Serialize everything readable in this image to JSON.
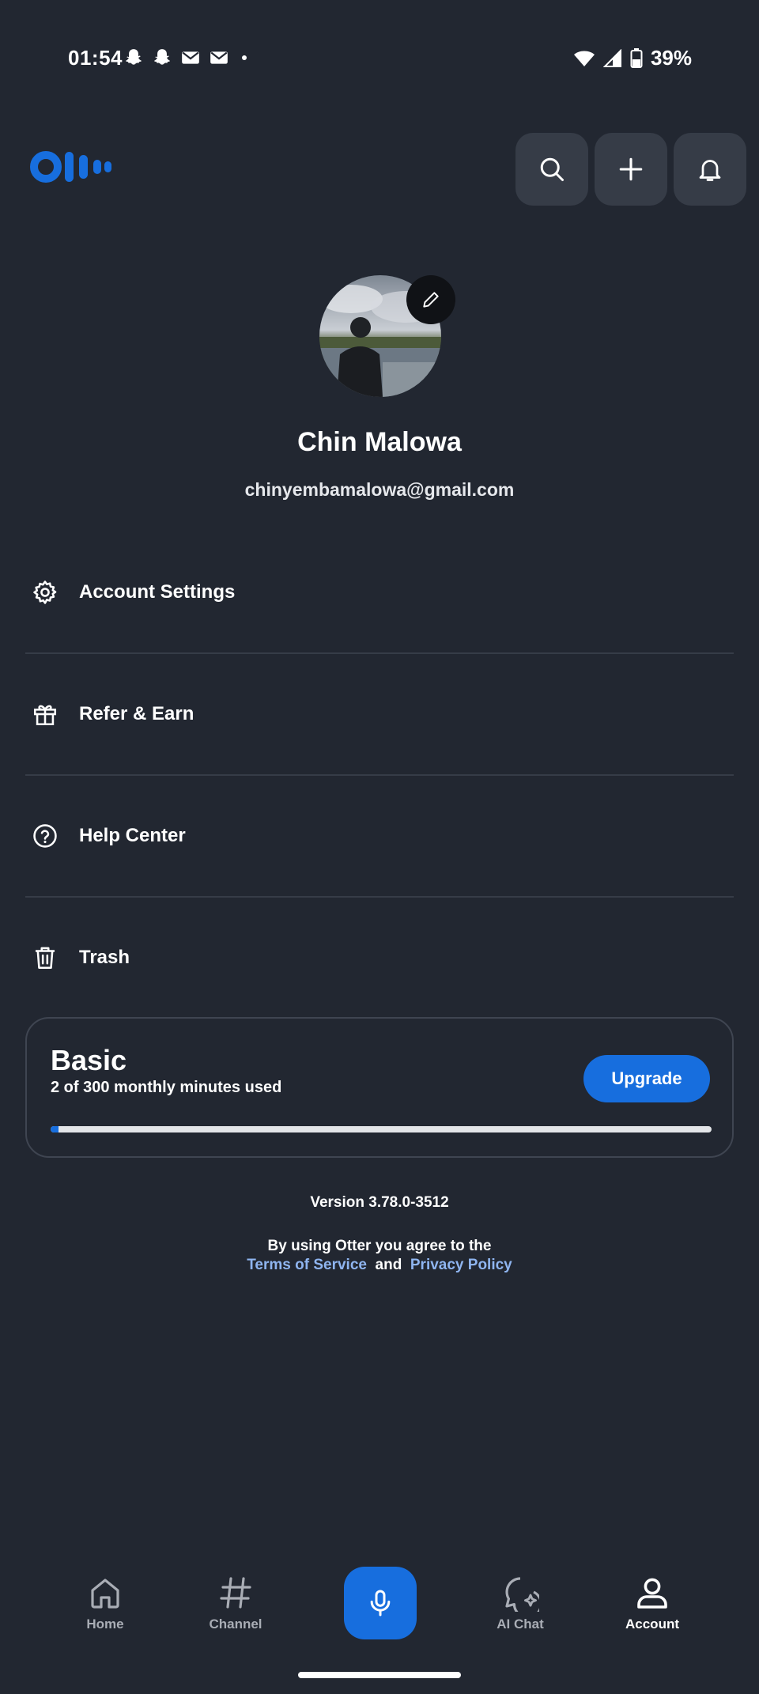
{
  "status_bar": {
    "time": "01:54",
    "notification_icons": [
      "snapchat-icon",
      "snapchat-icon",
      "gmail-icon",
      "gmail-icon",
      "dot-icon"
    ],
    "battery": "39%"
  },
  "header": {
    "logo": "otter-logo",
    "actions": [
      "search-icon",
      "plus-icon",
      "bell-icon"
    ]
  },
  "profile": {
    "name": "Chin Malowa",
    "email": "chinyembamalowa@gmail.com"
  },
  "menu": [
    {
      "label": "Account Settings",
      "icon": "gear-icon"
    },
    {
      "label": "Refer & Earn",
      "icon": "gift-icon"
    },
    {
      "label": "Help Center",
      "icon": "help-circle-icon"
    },
    {
      "label": "Trash",
      "icon": "trash-icon"
    }
  ],
  "plan": {
    "title": "Basic",
    "usage": "2 of 300 monthly minutes used",
    "upgrade_label": "Upgrade",
    "used_fraction": 0.0067
  },
  "footer": {
    "version": "Version 3.78.0-3512",
    "agree_text": "By using Otter you agree to the",
    "terms_label": "Terms of Service",
    "and_text": "and",
    "privacy_label": "Privacy Policy"
  },
  "bottom_nav": [
    {
      "label": "Home",
      "icon": "home-icon"
    },
    {
      "label": "Channel",
      "icon": "hash-icon"
    },
    {
      "label": "AI Chat",
      "icon": "ai-chat-icon"
    },
    {
      "label": "Account",
      "icon": "account-icon",
      "active": true
    }
  ],
  "colors": {
    "background": "#222731",
    "accent": "#176ede",
    "button_bg": "#363c47"
  }
}
